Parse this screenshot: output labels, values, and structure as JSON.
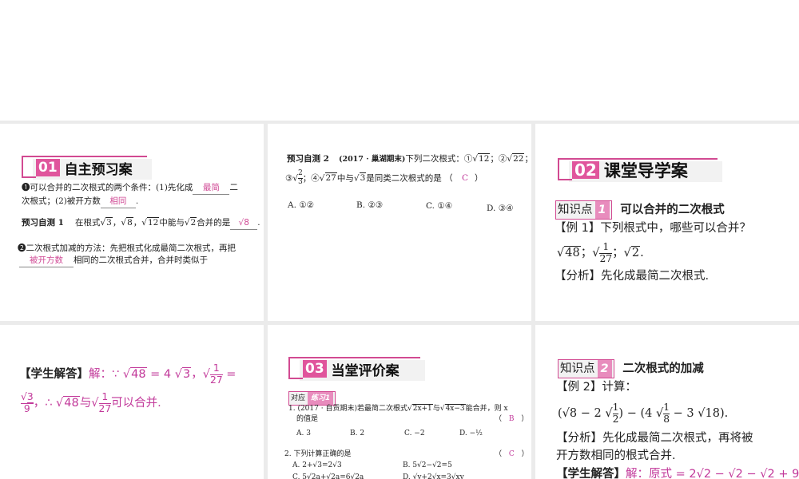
{
  "p1": {
    "num": "01",
    "title": "自主预习案",
    "l1a": "❶可以合并的二次根式的两个条件：(1)先化成",
    "b1": "最简",
    "l1b": "二",
    "l2a": "次根式；(2)被开方数",
    "b2": "相同",
    "l2b": ".",
    "t1": "预习自测 1",
    "t1a": "在根式",
    "r1": "3",
    "r2": "8",
    "r3": "12",
    "t1b": "中能与",
    "r4": "2",
    "t1c": "合并的是",
    "b3": "8",
    "t1d": ".",
    "l3": "❷二次根式加减的方法：先把根式化成最简二次根式，再把",
    "b4": "被开方数",
    "l4": "相同的二次根式合并，合并时类似于"
  },
  "p2": {
    "t": "预习自测 2",
    "src": "(2017 · 巢湖期末)",
    "q": "下列二次根式：①",
    "r1": "12",
    "s2": "；②",
    "r2": "22",
    "s3": "；",
    "s4": "③",
    "fn": "2",
    "fd": "3",
    "s5": "；④",
    "r4": "27",
    "s6": "中与",
    "r5": "3",
    "s7": "是同类二次根式的是 （",
    "ans": "C",
    "s8": "）",
    "opts": [
      "A. ①②",
      "B. ②③",
      "C. ①④",
      "D. ③④"
    ]
  },
  "p3": {
    "num": "02",
    "title": "课堂导学案",
    "kp": "知识点",
    "kpn": "1",
    "kpt": "可以合并的二次根式",
    "ex": "【例 1】下列根式中，哪些可以合并？",
    "r1": "48",
    "fn": "1",
    "fd": "27",
    "r3": "2",
    "an": "【分析】先化成最简二次根式."
  },
  "p4": {
    "lbl": "【学生解答】",
    "a1": "解：∵",
    "r1": "48",
    "a2": "= 4",
    "r2": "3",
    "a3": "，",
    "fn": "1",
    "fd": "27",
    "a4": "=",
    "f2n": "3",
    "f2d": "9",
    "a5": "，∴",
    "r3": "48",
    "a6": "与",
    "a7": "可以合并."
  },
  "p5": {
    "num": "03",
    "title": "当堂评价案",
    "tag": "对应",
    "tagn": "练习1",
    "q1": "1. (2017 · 自贡期末)若最简二次根式",
    "q1r1": "2x+1",
    "q1m": "与",
    "q1r2": "4x−3",
    "q1e": "能合并，则 x",
    "q1b": "的值是",
    "q1ans": "B",
    "q1opts": [
      "A. 3",
      "B. 2",
      "C. −2",
      "D. −½"
    ],
    "q2": "2. 下列计算正确的是",
    "q2ans": "C",
    "q2opts": [
      "A. 2+√3=2√3",
      "B. 5√2−√2=5",
      "C. 5√2a+√2a=6√2a",
      "D. √y+2√x=3√xy"
    ]
  },
  "p6": {
    "kp": "知识点",
    "kpn": "2",
    "kpt": "二次根式的加减",
    "ex": "【例 2】计算：",
    "expr1": "(√8 − 2",
    "fn": "1",
    "fd": "2",
    "expr2": ") − (4",
    "f2n": "1",
    "f2d": "8",
    "expr3": "− 3 √18).",
    "an1": "【分析】先化成最简二次根式，再将被",
    "an2": "开方数相同的根式合并.",
    "lbl": "【学生解答】",
    "sol": "解：原式 = 2√2 − √2 − √2 + 9"
  },
  "colors": {
    "accent": "#e0559c",
    "answer": "#c2399a",
    "separator": "#ebebeb"
  }
}
